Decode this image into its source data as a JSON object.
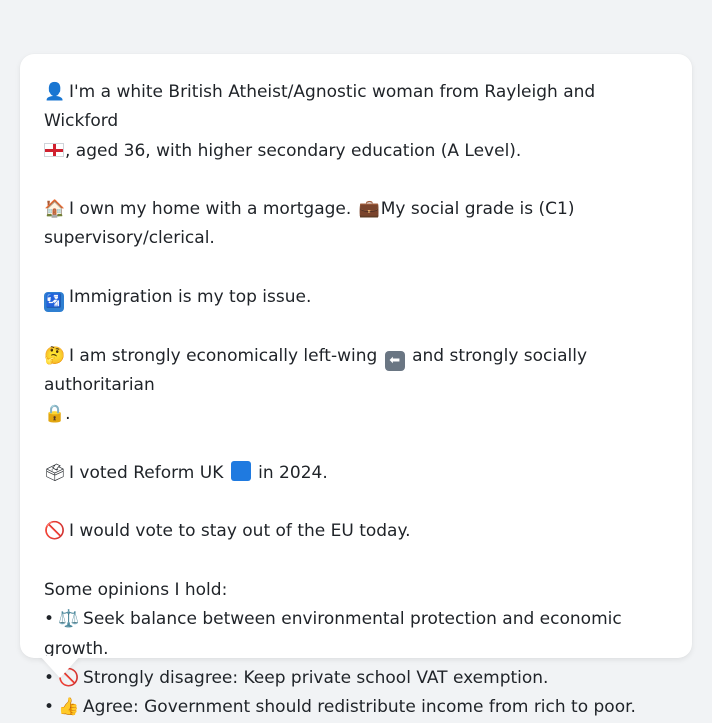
{
  "profile": {
    "line1": {
      "icon": "👤",
      "text_a": "I'm a white British Atheist/Agnostic woman from Rayleigh and Wickford",
      "flag": "england-flag",
      "text_b": ", aged 36, with higher secondary education (A Level)."
    },
    "line2": {
      "icon_home": "🏠",
      "text_a": "I own my home with a mortgage.",
      "icon_briefcase": "💼",
      "text_b": "My social grade is (C1)",
      "text_c": "supervisory/clerical."
    },
    "line3": {
      "icon": "🛂",
      "text": "Immigration is my top issue."
    },
    "line4": {
      "icon": "🤔",
      "text_a": "I am strongly economically left-wing",
      "icon_arrow": "⬅",
      "text_b": "and strongly socially authoritarian",
      "icon_lock": "🔒",
      "text_c": "."
    },
    "line5": {
      "icon": "🗳",
      "text_a": "I voted Reform UK",
      "text_b": "in 2024."
    },
    "line6": {
      "icon": "🚫",
      "text": "I would vote to stay out of the EU today."
    },
    "opinions": {
      "heading": "Some opinions I hold:",
      "bullet": "•",
      "items": [
        {
          "icon": "⚖️",
          "text": "Seek balance between environmental protection and economic growth."
        },
        {
          "icon": "🚫",
          "text": "Strongly disagree: Keep private school VAT exemption."
        },
        {
          "icon": "👍",
          "text": "Agree: Government should redistribute income from rich to poor."
        }
      ]
    }
  },
  "colors": {
    "background": "#f1f3f5",
    "card": "#ffffff",
    "text": "#1f2328",
    "reform_blue": "#1f7ae0"
  }
}
